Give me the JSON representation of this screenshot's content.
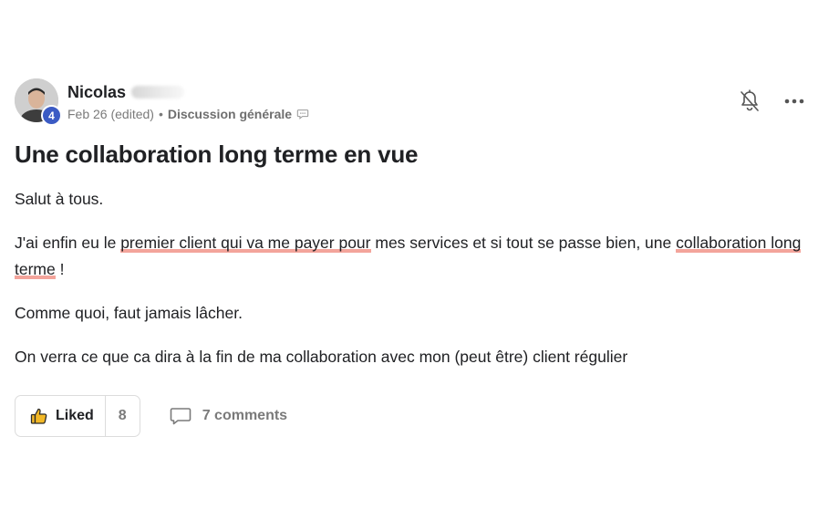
{
  "post": {
    "author": {
      "name": "Nicolas",
      "level": "4",
      "avatar_icon": "user-avatar"
    },
    "date": "Feb 26 (edited)",
    "separator": "•",
    "category": "Discussion générale",
    "category_icon": "speech-bubble-icon",
    "title": "Une collaboration long terme en vue",
    "paragraphs": {
      "p1": "Salut à tous.",
      "p2": {
        "before": "J'ai enfin eu le ",
        "highlight1": "premier client qui va me payer pour",
        "middle": " mes services et si tout se passe bien, une ",
        "highlight2": "collaboration long terme",
        "after": " !"
      },
      "p3": "Comme quoi, faut jamais lâcher.",
      "p4": "On verra ce que ca dira à la fin de ma collaboration avec mon (peut être) client régulier"
    },
    "highlight_color": "#f3a49b",
    "like": {
      "label": "Liked",
      "count": "8",
      "icon": "thumbs-up-icon"
    },
    "comments": {
      "label": "7 comments",
      "icon": "comment-icon"
    },
    "actions": {
      "bell_icon": "bell-off-icon",
      "more_icon": "more-horizontal-icon"
    },
    "colors": {
      "badge": "#3b5bc4",
      "text": "#202124",
      "muted": "#7a7a7a",
      "like_icon": "#f2b827"
    }
  }
}
